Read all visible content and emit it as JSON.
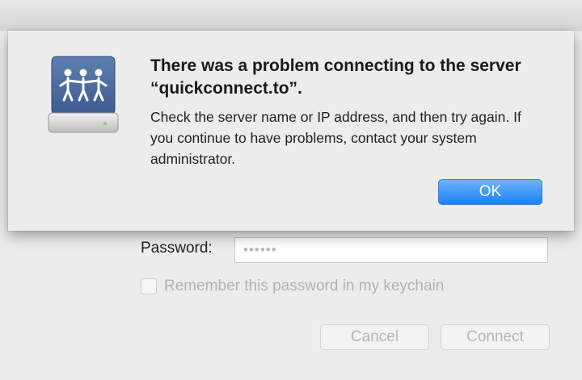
{
  "alert": {
    "title": "There was a problem connecting to the server “quickconnect.to”.",
    "message": "Check the server name or IP address, and then try again. If you continue to have problems, contact your system administrator.",
    "ok_label": "OK",
    "icon": "shared-server-drive-icon"
  },
  "login": {
    "password_label": "Password:",
    "password_value": "••••••",
    "remember_label": "Remember this password in my keychain",
    "remember_checked": false,
    "cancel_label": "Cancel",
    "connect_label": "Connect"
  },
  "colors": {
    "accent": "#1a82fb",
    "background": "#ececec"
  }
}
